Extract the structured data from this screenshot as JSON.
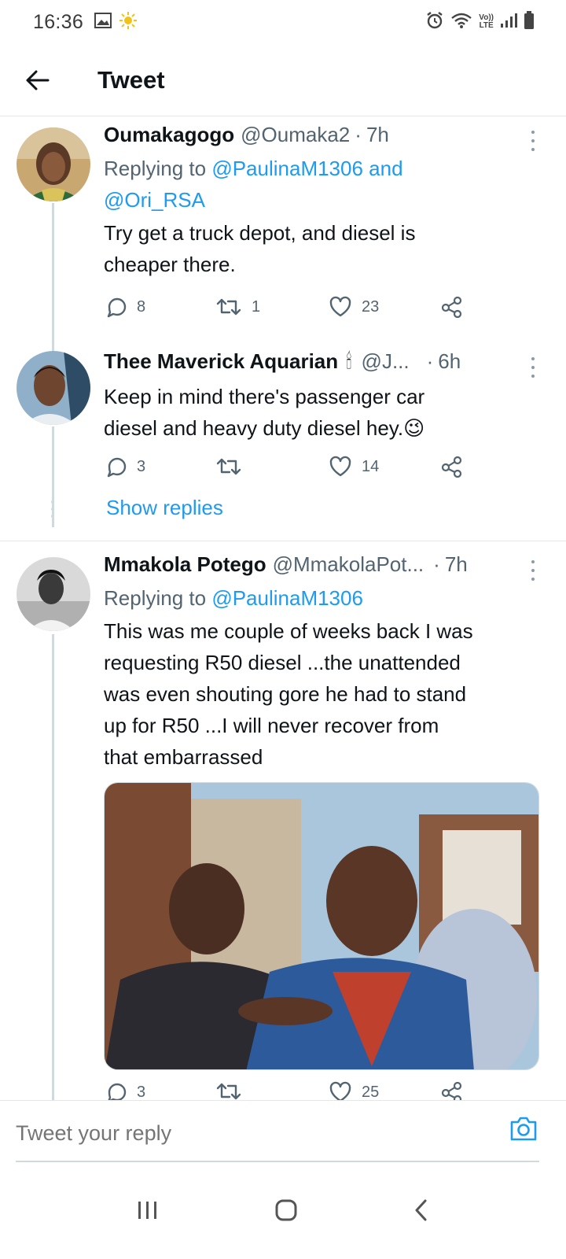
{
  "status_bar": {
    "time": "16:36",
    "network_label_top": "Vo))",
    "network_label_bottom": "LTE"
  },
  "header": {
    "title": "Tweet",
    "back_icon": "arrow-left-icon"
  },
  "tweets": [
    {
      "name": "Oumakagogo",
      "handle": "@Oumaka2",
      "time": "7h",
      "replying_prefix": "Replying to",
      "replying_line1": "@PaulinaM1306 and",
      "replying_line2": "@Ori_RSA",
      "text_line1": "Try get a truck depot, and diesel is",
      "text_line2": "cheaper there.",
      "replies": "8",
      "retweets": "1",
      "likes": "23"
    },
    {
      "name": "Thee Maverick Aquarian",
      "name_emoji": "🕯",
      "handle": "@J...",
      "time": "6h",
      "text_line1": "Keep in mind there's passenger car",
      "text_line2": "diesel and heavy duty diesel hey.",
      "text_emoji": "😉",
      "replies": "3",
      "retweets": "",
      "likes": "14"
    },
    {
      "name": "Mmakola Potego",
      "handle": "@MmakolaPot...",
      "time": "7h",
      "replying_prefix": "Replying to",
      "replying_line1": "@PaulinaM1306",
      "text_line1": "This was me couple of weeks back I was",
      "text_line2": "requesting R50 diesel ...the unattended",
      "text_line3": "was even shouting gore he had to stand",
      "text_line4": "up for R50 ...I will never recover from",
      "text_line5": "that embarrassed",
      "replies": "3",
      "retweets": "",
      "likes": "25"
    }
  ],
  "show_replies": "Show replies",
  "reply_bar": {
    "placeholder": "Tweet your reply"
  },
  "colors": {
    "accent": "#1d9bf0",
    "secondary_text": "#536471",
    "primary_text": "#0f1419",
    "divider": "#e6e6e6"
  }
}
